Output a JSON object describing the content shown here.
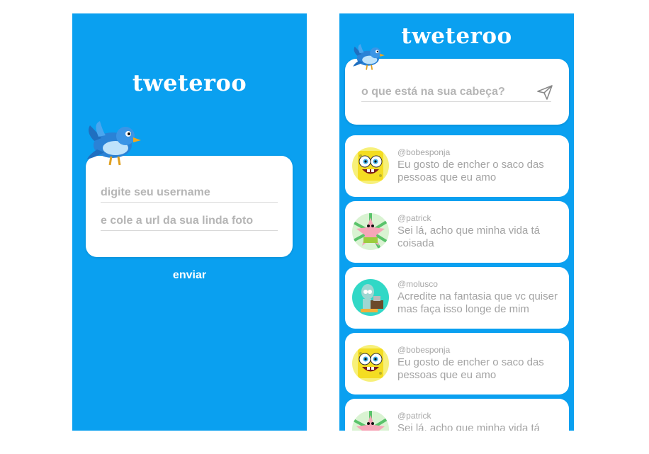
{
  "login": {
    "brand": "tweteroo",
    "username_placeholder": "digite seu username",
    "avatar_placeholder": "e cole a url da sua linda foto",
    "submit_label": "enviar"
  },
  "feed": {
    "brand": "tweteroo",
    "compose_placeholder": "o que está na sua cabeça?",
    "tweets": [
      {
        "username": "@bobesponja",
        "text": "Eu gosto de encher o saco das pessoas que eu amo",
        "avatar": "spongebob-avatar"
      },
      {
        "username": "@patrick",
        "text": "Sei lá, acho que minha vida tá coisada",
        "avatar": "patrick-avatar"
      },
      {
        "username": "@molusco",
        "text": "Acredite na fantasia que vc quiser mas faça isso longe de mim",
        "avatar": "squidward-avatar"
      },
      {
        "username": "@bobesponja",
        "text": "Eu gosto de encher o saco das pessoas que eu amo",
        "avatar": "spongebob-avatar"
      },
      {
        "username": "@patrick",
        "text": "Sei lá, acho que minha vida tá coisada",
        "avatar": "patrick-avatar"
      }
    ]
  },
  "colors": {
    "primary": "#0aa0f0",
    "card": "#ffffff",
    "muted_text": "#a3a3a3"
  },
  "icons": {
    "logo": "bird-icon",
    "send": "send-icon"
  }
}
